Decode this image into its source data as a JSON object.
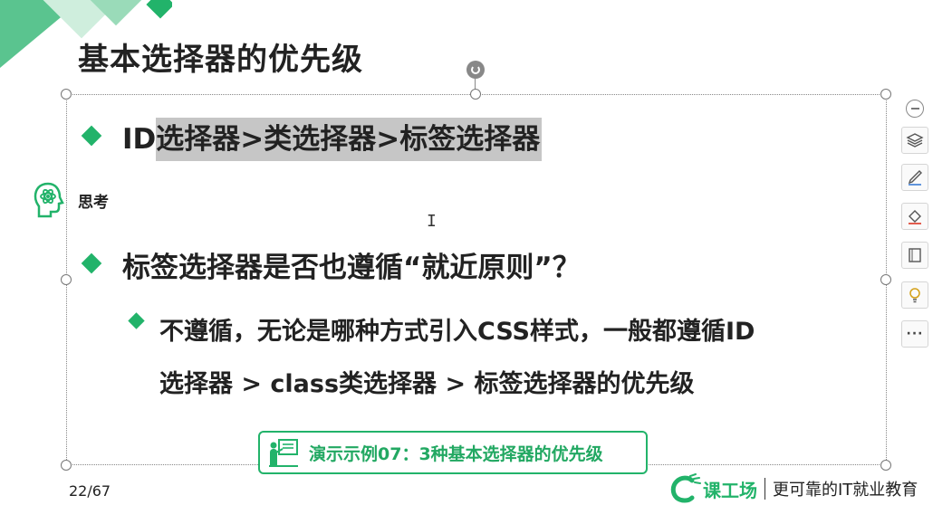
{
  "slide": {
    "title": "基本选择器的优先级",
    "bullet1_prefix": "ID",
    "bullet1_highlight": "选择器>类选择器>标签选择器",
    "think_label": "思考",
    "bullet2": "标签选择器是否也遵循“就近原则”？",
    "sub_bullet_line1": "不遵循，无论是哪种方式引入CSS样式，一般都遵循ID",
    "sub_bullet_line2": "选择器 > class类选择器 > 标签选择器的优先级",
    "demo_label": "演示示例07：3种基本选择器的优先级",
    "page_number": "22/67"
  },
  "brand": {
    "name": "课工场",
    "slogan": "更可靠的IT就业教育"
  },
  "toolbar": {
    "more_label": "···"
  },
  "colors": {
    "accent": "#22b36a",
    "highlight": "#c6c6c6"
  }
}
